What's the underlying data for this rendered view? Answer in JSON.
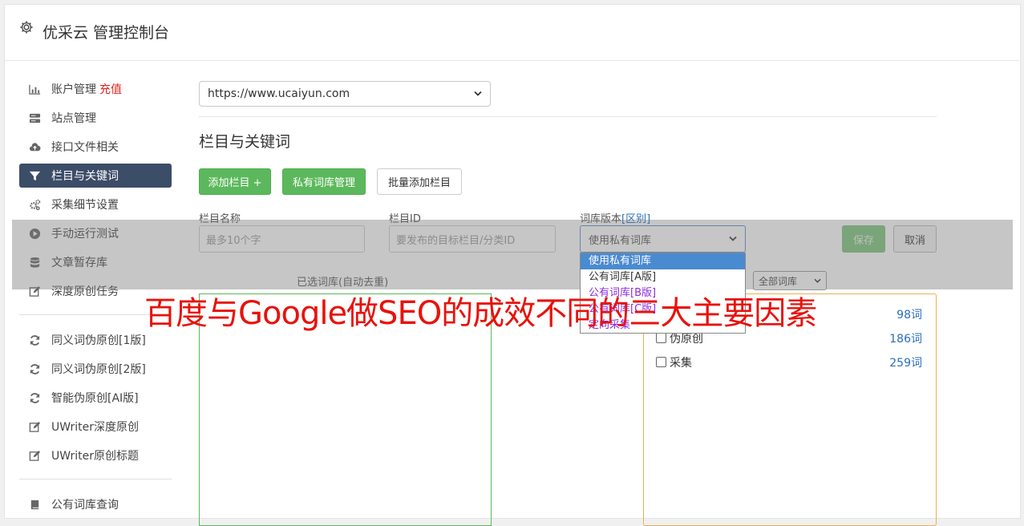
{
  "header": {
    "title": "优采云 管理控制台"
  },
  "sidebar": {
    "items": [
      {
        "label": "账户管理",
        "extra": "充值",
        "icon": "bar-chart-icon"
      },
      {
        "label": "站点管理",
        "icon": "server-icon"
      },
      {
        "label": "接口文件相关",
        "icon": "cloud-upload-icon"
      },
      {
        "label": "栏目与关键词",
        "icon": "filter-icon",
        "active": true
      },
      {
        "label": "采集细节设置",
        "icon": "gears-icon"
      },
      {
        "label": "手动运行测试",
        "icon": "play-circle-icon"
      },
      {
        "label": "文章暂存库",
        "icon": "database-icon"
      },
      {
        "label": "深度原创任务",
        "icon": "edit-icon"
      }
    ],
    "items2": [
      {
        "label": "同义词伪原创[1版]",
        "icon": "refresh-icon"
      },
      {
        "label": "同义词伪原创[2版]",
        "icon": "refresh-icon"
      },
      {
        "label": "智能伪原创[AI版]",
        "icon": "refresh-icon"
      },
      {
        "label": "UWriter深度原创",
        "icon": "edit-icon"
      },
      {
        "label": "UWriter原创标题",
        "icon": "edit-icon"
      }
    ],
    "items3": [
      {
        "label": "公有词库查询",
        "icon": "book-icon"
      }
    ]
  },
  "site_select": {
    "value": "https://www.ucaiyun.com"
  },
  "section": {
    "title": "栏目与关键词"
  },
  "buttons": {
    "add_column": "添加栏目 +",
    "private_lib": "私有词库管理",
    "batch_add": "批量添加栏目",
    "save": "保存",
    "cancel": "取消"
  },
  "form": {
    "name_label": "栏目名称",
    "name_placeholder": "最多10个字",
    "id_label": "栏目ID",
    "id_placeholder": "要发布的目标栏目/分类ID",
    "version_label": "词库版本",
    "version_link": "[区别]",
    "version_value": "使用私有词库"
  },
  "dropdown": {
    "options": [
      "使用私有词库",
      "公有词库[A版]",
      "公有词库[B版]",
      "公有词库[C版]",
      "定向采集"
    ]
  },
  "lists": {
    "selected_label": "已选词库(自动去重)",
    "filter_value": "全部词库",
    "libraries": [
      {
        "name": "",
        "count": "98词"
      },
      {
        "name": "伪原创",
        "count": "186词"
      },
      {
        "name": "采集",
        "count": "259词"
      }
    ]
  },
  "watermark": {
    "text": "百度与Google做SEO的成效不同的三大主要因素"
  },
  "colors": {
    "accent_green": "#5cb85c",
    "active_nav": "#3c4d68",
    "recharge_red": "#e0241b",
    "watermark_red": "#e8120c"
  }
}
